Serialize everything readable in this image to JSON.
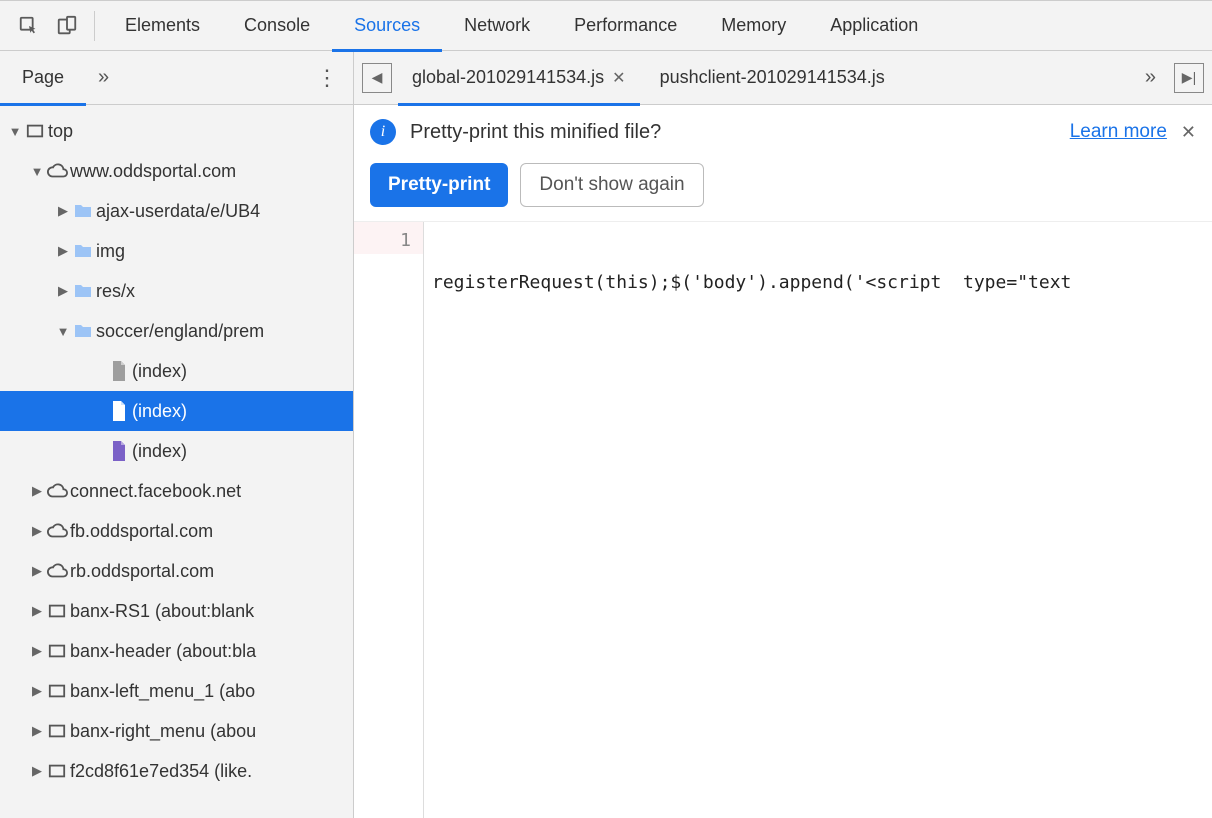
{
  "devtools": {
    "tabs": [
      "Elements",
      "Console",
      "Sources",
      "Network",
      "Performance",
      "Memory",
      "Application"
    ],
    "active_index": 2
  },
  "sidebar": {
    "tab_label": "Page",
    "tree": {
      "top": "top",
      "domain0": "www.oddsportal.com",
      "folders": [
        "ajax-userdata/e/UB4",
        "img",
        "res/x",
        "soccer/england/prem"
      ],
      "files": [
        "(index)",
        "(index)",
        "(index)"
      ],
      "other_domains": [
        "connect.facebook.net",
        "fb.oddsportal.com",
        "rb.oddsportal.com"
      ],
      "frames": [
        "banx-RS1 (about:blank",
        "banx-header (about:bla",
        "banx-left_menu_1 (abo",
        "banx-right_menu (abou",
        "f2cd8f61e7ed354 (like."
      ]
    }
  },
  "file_tabs": {
    "items": [
      "global-201029141534.js",
      "pushclient-201029141534.js"
    ],
    "active_index": 0
  },
  "infobar": {
    "question": "Pretty-print this minified file?",
    "learn_more": "Learn more",
    "pretty_print": "Pretty-print",
    "dont_show": "Don't show again"
  },
  "code": {
    "line_number": "1",
    "content": "registerRequest(this);$('body').append('<script  type=\"text"
  }
}
